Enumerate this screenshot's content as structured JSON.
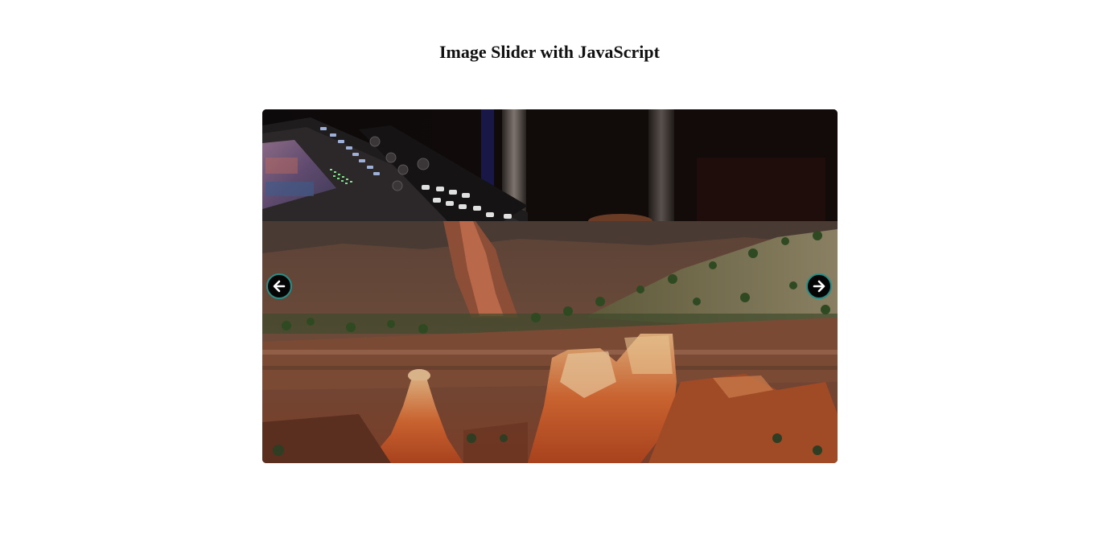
{
  "page": {
    "title": "Image Slider with JavaScript"
  },
  "slider": {
    "slides": [
      {
        "name": "audio-mixer-photo"
      },
      {
        "name": "canyon-landscape-photo"
      }
    ],
    "prev_icon": "arrow-left-icon",
    "next_icon": "arrow-right-icon"
  },
  "colors": {
    "background": "#ffffff",
    "title_text": "#111111",
    "button_fill": "#050505",
    "button_border": "#2a8e86",
    "button_arrow": "#ffffff"
  }
}
